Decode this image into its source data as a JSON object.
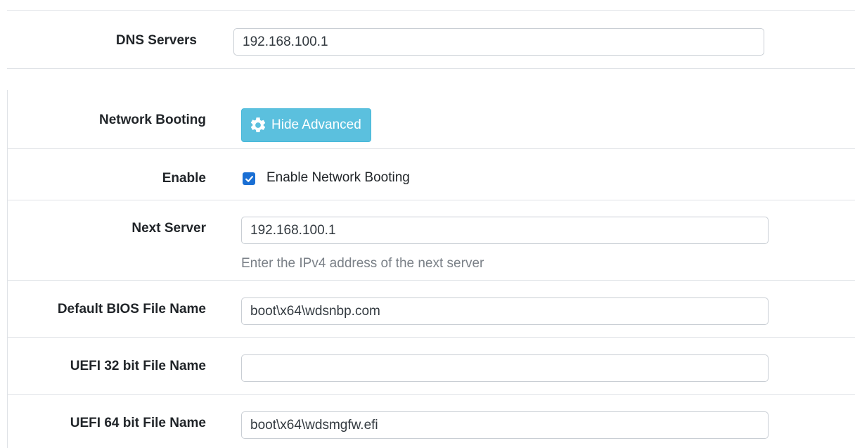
{
  "dns_servers": {
    "label": "DNS Servers",
    "value": "192.168.100.1"
  },
  "network_booting": {
    "label": "Network Booting",
    "button_label": "Hide Advanced",
    "button_icon": "gear-icon"
  },
  "enable": {
    "label": "Enable",
    "checkbox_label": "Enable Network Booting",
    "checked": true
  },
  "next_server": {
    "label": "Next Server",
    "value": "192.168.100.1",
    "help": "Enter the IPv4 address of the next server"
  },
  "default_bios": {
    "label": "Default BIOS File Name",
    "value": "boot\\x64\\wdsnbp.com"
  },
  "uefi32": {
    "label": "UEFI 32 bit File Name",
    "value": ""
  },
  "uefi64": {
    "label": "UEFI 64 bit File Name",
    "value": "boot\\x64\\wdsmgfw.efi"
  },
  "colors": {
    "info_button": "#5bc0de",
    "checkbox": "#1a6fd4",
    "help_text": "#7a8087",
    "divider": "#dfe2e6"
  }
}
